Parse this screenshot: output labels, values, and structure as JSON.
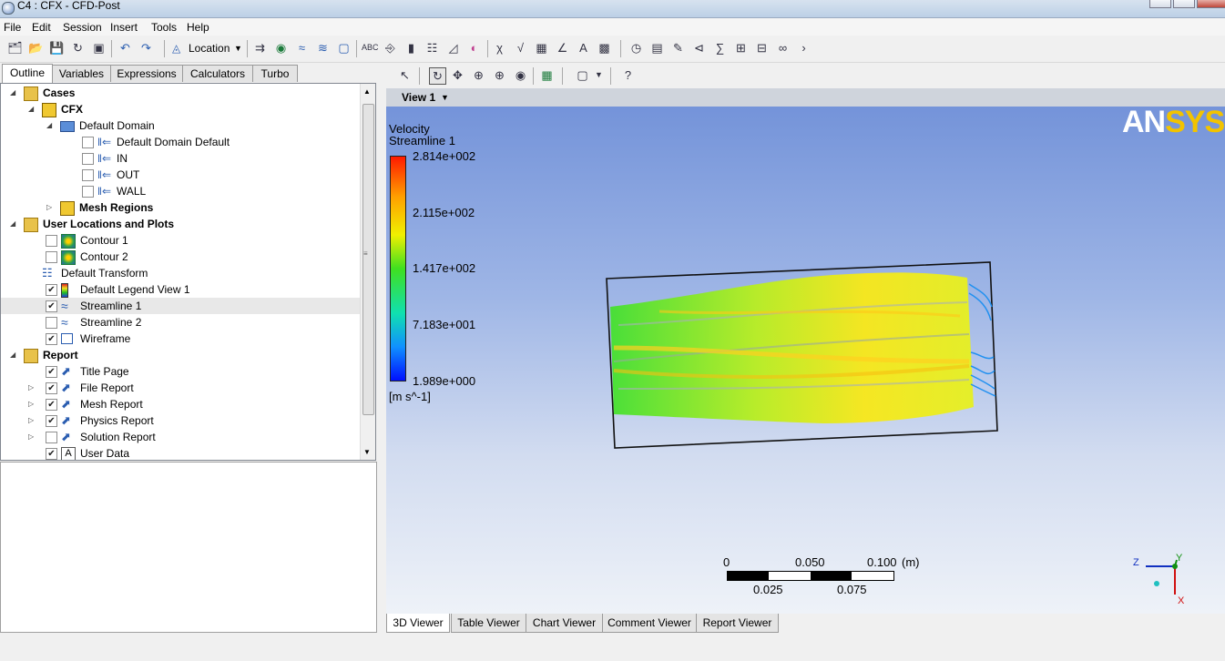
{
  "window": {
    "title": "C4 : CFX - CFD-Post"
  },
  "menu": [
    "File",
    "Edit",
    "Session",
    "Insert",
    "Tools",
    "Help"
  ],
  "toolbar": {
    "location_label": "Location"
  },
  "left_tabs": [
    "Outline",
    "Variables",
    "Expressions",
    "Calculators",
    "Turbo"
  ],
  "tree": {
    "cases": "Cases",
    "cfx": "CFX",
    "default_domain": "Default Domain",
    "ddd": "Default Domain Default",
    "in": "IN",
    "out": "OUT",
    "wall": "WALL",
    "mesh_regions": "Mesh Regions",
    "user_locations": "User Locations and Plots",
    "contour1": "Contour 1",
    "contour2": "Contour 2",
    "default_transform": "Default Transform",
    "legend_view": "Default Legend View 1",
    "streamline1": "Streamline 1",
    "streamline2": "Streamline 2",
    "wireframe": "Wireframe",
    "report": "Report",
    "title_page": "Title Page",
    "file_report": "File Report",
    "mesh_report": "Mesh Report",
    "physics_report": "Physics Report",
    "solution_report": "Solution Report",
    "user_data": "User Data"
  },
  "checks": {
    "ddd": false,
    "in": false,
    "out": false,
    "wall": false,
    "contour1": false,
    "contour2": false,
    "legend_view": true,
    "streamline1": true,
    "streamline2": false,
    "wireframe": true,
    "title_page": true,
    "file_report": true,
    "mesh_report": true,
    "physics_report": true,
    "solution_report": false,
    "user_data": true
  },
  "viewer": {
    "view_label": "View 1",
    "logo": "ANSYS",
    "legend": {
      "title": "Velocity",
      "subtitle": "Streamline 1",
      "values": [
        "2.814e+002",
        "2.115e+002",
        "1.417e+002",
        "7.183e+001",
        "1.989e+000"
      ],
      "units": "[m s^-1]"
    },
    "scale": {
      "top": [
        "0",
        "0.050",
        "0.100"
      ],
      "unit": "(m)",
      "bottom": [
        "0.025",
        "0.075"
      ]
    },
    "axes": {
      "z": "Z",
      "y": "Y",
      "x": "X"
    }
  },
  "bottom_tabs": [
    "3D Viewer",
    "Table Viewer",
    "Chart Viewer",
    "Comment Viewer",
    "Report Viewer"
  ],
  "colors": {
    "x_axis": "#d01010",
    "y_axis": "#109010",
    "z_axis": "#1030c0",
    "ansys_yellow": "#f2c300"
  }
}
